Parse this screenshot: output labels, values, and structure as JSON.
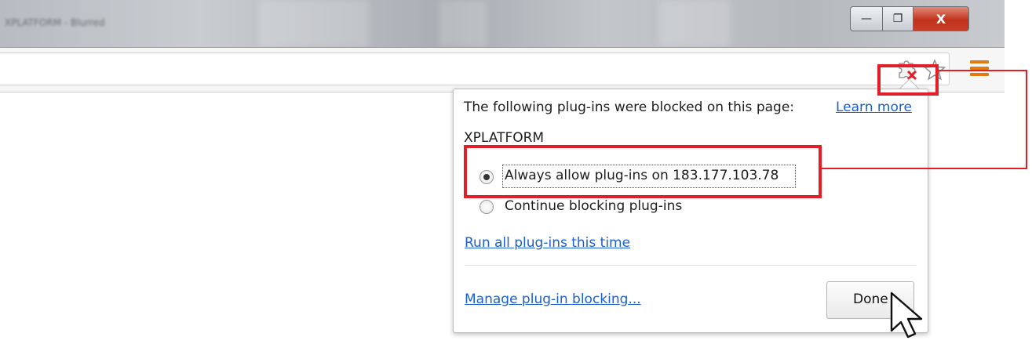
{
  "window": {
    "title": "XPLATFORM - Blurred",
    "min_glyph": "—",
    "max_glyph": "❐",
    "close_glyph": "X"
  },
  "toolbar": {
    "plugin_icon": "plugin-blocked-icon",
    "star_icon": "bookmark-star-icon",
    "menu_icon": "hamburger-menu-icon"
  },
  "bubble": {
    "heading": "The following plug-ins were blocked on this page:",
    "learn_more": "Learn more",
    "plugin_name": "XPLATFORM",
    "options": [
      {
        "label": "Always allow plug-ins on 183.177.103.78",
        "selected": true
      },
      {
        "label": "Continue blocking plug-ins",
        "selected": false
      }
    ],
    "run_all": "Run all plug-ins this time",
    "manage": "Manage plug-in blocking...",
    "done": "Done"
  },
  "colors": {
    "annotation": "#e41e26",
    "link": "#1a5fd0",
    "menu_orange": "#e07b12",
    "close_red": "#c1321b"
  }
}
